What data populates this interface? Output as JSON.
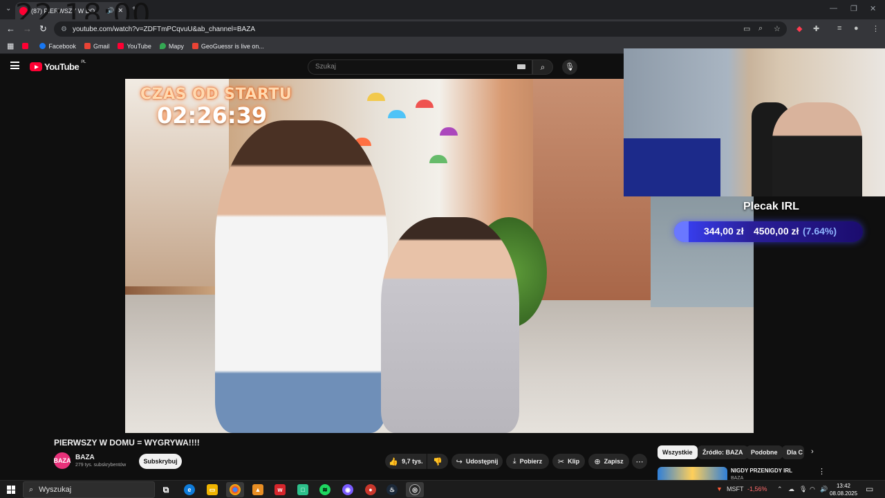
{
  "browser": {
    "tab_title": "(87) PIERWSZY W DO",
    "overlay_clock": "22:18:00",
    "url": "youtube.com/watch?v=ZDFTmPCqvuU&ab_channel=BAZA",
    "bookmarks": [
      {
        "label": "",
        "color": "#ff0033"
      },
      {
        "label": "Facebook",
        "color": "#1877f2"
      },
      {
        "label": "Gmail",
        "color": "#ea4335"
      },
      {
        "label": "YouTube",
        "color": "#ff0033"
      },
      {
        "label": "Mapy",
        "color": "#34a853"
      },
      {
        "label": "GeoGuessr is live on...",
        "color": "#ea4335"
      }
    ]
  },
  "youtube": {
    "logo_text": "YouTube",
    "logo_region": "PL",
    "search_placeholder": "Szukaj",
    "video_overlay": {
      "label": "CZAS OD STARTU",
      "timer": "02:26:39"
    },
    "stream_goal": {
      "title": "Plecak IRL",
      "current": "344,00 zł",
      "target": "4500,00 zł",
      "percent": "(7.64%)",
      "fraction": 0.0764
    },
    "video_title": "PIERWSZY W DOMU = WYGRYWA!!!!",
    "channel": {
      "avatar_text": "BAZA",
      "name": "BAZA",
      "subs": "279 tys. subskrybentów"
    },
    "subscribe_label": "Subskrybuj",
    "actions": {
      "like": "9,7 tys.",
      "share": "Udostępnij",
      "download": "Pobierz",
      "clip": "Klip",
      "save": "Zapisz"
    },
    "chips": [
      "Wszystkie",
      "Źródło: BAZA",
      "Podobne",
      "Dla C"
    ],
    "recommended": {
      "title": "NIGDY PRZENIGDY IRL",
      "channel": "BAZA"
    }
  },
  "taskbar": {
    "search_label": "Wyszukaj",
    "stock": {
      "ticker": "MSFT",
      "change": "-1,56%"
    },
    "time": "13:42",
    "date": "08.08.2025"
  }
}
